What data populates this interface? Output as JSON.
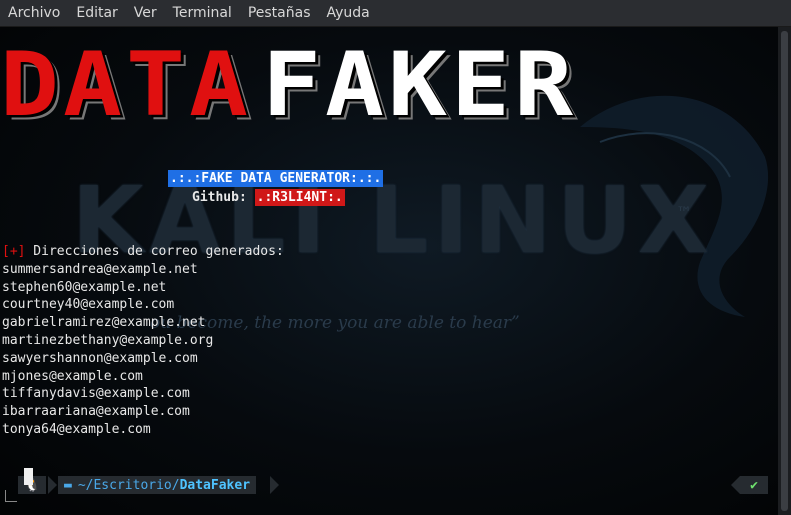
{
  "menu": {
    "items": [
      "Archivo",
      "Editar",
      "Ver",
      "Terminal",
      "Pestañas",
      "Ayuda"
    ]
  },
  "wallpaper": {
    "brand": "KALI LINUX",
    "tm": "™",
    "quote": "ou become, the more you are able to hear”"
  },
  "banner": {
    "left": "DATA",
    "right": "FAKER"
  },
  "subtitle": ".:.:FAKE DATA GENERATOR:.:.",
  "github": {
    "label": "Github:",
    "handle": ".:R3LI4NT:."
  },
  "result": {
    "marker": "[+]",
    "heading": " Direcciones de correo generados:",
    "emails": [
      "summersandrea@example.net",
      "stephen60@example.net",
      "courtney40@example.com",
      "gabrielramirez@example.net",
      "martinezbethany@example.org",
      "sawyershannon@example.com",
      "mjones@example.com",
      "tiffanydavis@example.com",
      "ibarraariana@example.com",
      "tonya64@example.com"
    ]
  },
  "prompt": {
    "os_icon": "linux-tux-icon",
    "folder_icon": "folder-icon",
    "path_prefix": "~/Escritorio/",
    "path_current": "DataFaker",
    "status_glyph": "✔",
    "colors": {
      "ok": "#6ee06e",
      "path": "#4aa8e8"
    }
  },
  "colors": {
    "banner_red": "#e01010",
    "subtitle_bg": "#1f6fe5",
    "github_bg": "#d01818"
  }
}
